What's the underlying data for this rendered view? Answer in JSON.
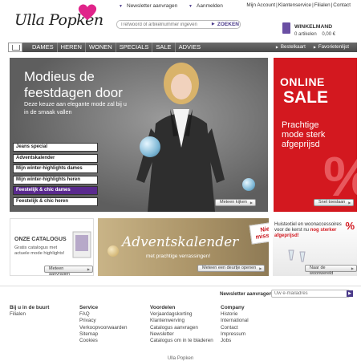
{
  "header": {
    "logo": "Ulla Popken",
    "newsletter_link": "Newsletter aanvragen",
    "login_link": "Aanmelden",
    "top_links": [
      "Mijn Account",
      "Klantenservice",
      "Filialen",
      "Contact"
    ],
    "search_placeholder": "Trefwoord of artikelnummer ingeven",
    "search_button": "ZOEKEN",
    "cart_title": "WINKELMAND",
    "cart_items": "0 artikelen",
    "cart_total": "0,00 €"
  },
  "nav": {
    "items": [
      "DAMES",
      "HEREN",
      "WONEN",
      "SPECIALS",
      "SALE",
      "ADVIES"
    ],
    "right": [
      "Bestelkaart",
      "Favorietenlijst"
    ]
  },
  "hero": {
    "title_line1": "Modieus de",
    "title_line2": "feestdagen door",
    "sub_line1": "Deze keuze aan elegante mode zal bij u",
    "sub_line2": "in de smaak vallen",
    "links": [
      "Jeans special",
      "Adventskalender",
      "Mijn winter-highlights dames",
      "Mijn winter-highlights heren",
      "Feestelijk & chic dames",
      "Feestelijk & chic heren"
    ],
    "active_index": 4,
    "cta": "Meteen kijken"
  },
  "sale": {
    "line1": "ONLINE",
    "line2": "SALE",
    "body1": "Prachtige",
    "body2": "mode sterk",
    "body3": "afgeprijsd",
    "cta": "Snel toeslaan",
    "percent": "%"
  },
  "promos": {
    "catalog_title": "ONZE CATALOGUS",
    "catalog_text": "Gratis catalogus met actuele mode highlights!",
    "catalog_cta": "Meteen aanvragen",
    "advent_title": "Adventskalender",
    "advent_sub": "met prachtige verrassingen!",
    "advent_tag1": "Niet",
    "advent_tag2": "missen!",
    "advent_cta": "Meteen een deurtje openen",
    "home_text1": "Huistextiel en woonaccessoires",
    "home_text2": "voor de kerst nu ",
    "home_text3": "nog sterker afgeprijsd!",
    "home_cta": "Naar de woonwereld",
    "home_pct": "%"
  },
  "newsletter": {
    "label": "Newsletter aanvragen",
    "placeholder": "Uw e-mailadres"
  },
  "footer": {
    "columns": [
      {
        "title": "Bij u in de buurt",
        "links": [
          "Filialen"
        ]
      },
      {
        "title": "Service",
        "links": [
          "FAQ",
          "Privacy",
          "Verkoopvoorwaarden",
          "Sitemap",
          "Cookies"
        ]
      },
      {
        "title": "Voordelen",
        "links": [
          "Verjaardagskorting",
          "Klantenwerving",
          "Catalogus aanvragen",
          "Newsletter",
          "Catalogus om in te bladeren"
        ]
      },
      {
        "title": "Company",
        "links": [
          "Historie",
          "International",
          "Contact",
          "Impressum",
          "Jobs"
        ]
      }
    ],
    "copyright": "Ulla Popken"
  },
  "colors": {
    "brand_purple": "#4a3a8a",
    "sale_red": "#d3181f",
    "nav_gray": "#555555"
  }
}
